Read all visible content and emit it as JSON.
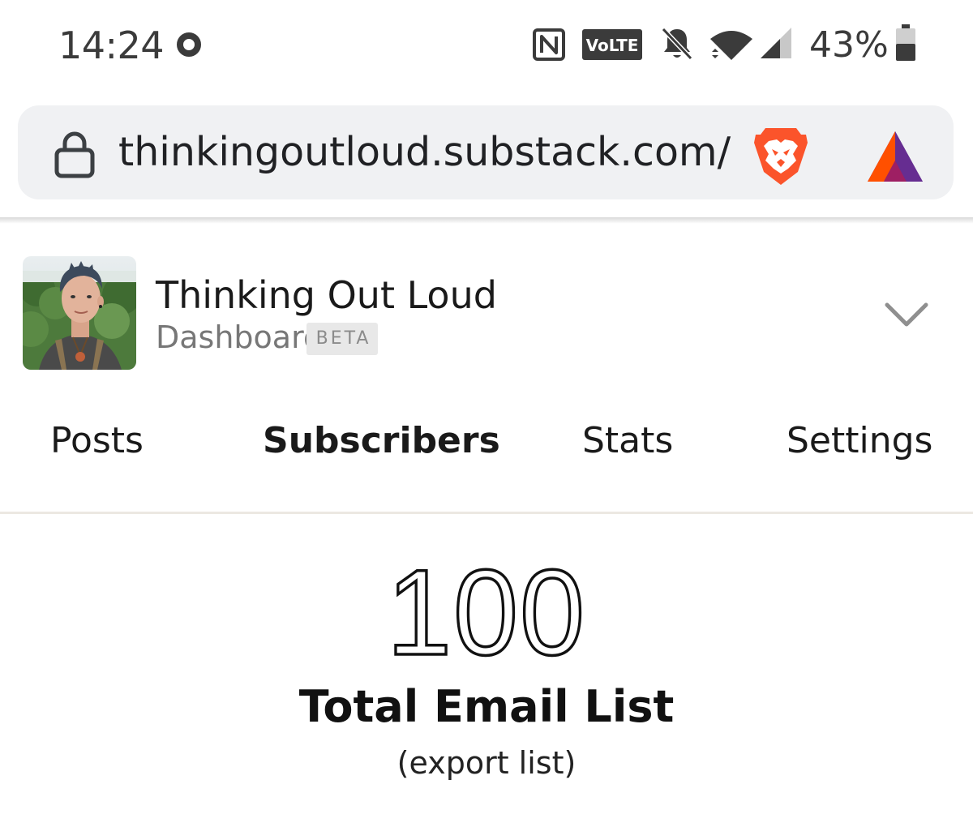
{
  "status_bar": {
    "time": "14:24",
    "battery_percent": "43%",
    "volte_label": "VoLTE",
    "icons": [
      "record-dot-icon",
      "nfc-icon",
      "volte-icon",
      "bell-off-icon",
      "wifi-icon",
      "cell-signal-icon",
      "battery-icon"
    ]
  },
  "browser": {
    "url": "thinkingoutloud.substack.com/",
    "icons": [
      "lock-icon",
      "brave-shield-icon",
      "bat-rewards-icon"
    ],
    "brave_color": "#fb542b",
    "bat_colors": [
      "#662d91",
      "#ff5000",
      "#9e1f63"
    ]
  },
  "publication": {
    "title": "Thinking Out Loud",
    "subtitle": "Dashboard",
    "badge": "BETA"
  },
  "tabs": [
    {
      "label": "Posts",
      "active": false
    },
    {
      "label": "Subscribers",
      "active": true
    },
    {
      "label": "Stats",
      "active": false
    },
    {
      "label": "Settings",
      "active": false
    }
  ],
  "stats": {
    "total": "100",
    "label": "Total Email List",
    "export_link": "(export list)"
  }
}
